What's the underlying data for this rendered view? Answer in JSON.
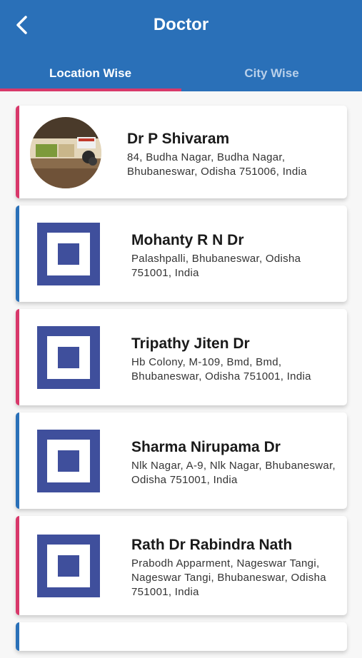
{
  "header": {
    "title": "Doctor"
  },
  "tabs": [
    {
      "label": "Location Wise",
      "active": true
    },
    {
      "label": "City Wise",
      "active": false
    }
  ],
  "colors": {
    "primary": "#2a70b8",
    "accent": "#d8386a",
    "placeholder": "#3f4f9c"
  },
  "doctors": [
    {
      "name": "Dr P Shivaram",
      "address": "84, Budha Nagar, Budha Nagar, Bhubaneswar, Odisha 751006, India",
      "image": "photo",
      "stripe": "pink"
    },
    {
      "name": "Mohanty R N Dr",
      "address": "Palashpalli, Bhubaneswar, Odisha 751001, India",
      "image": "placeholder-icon",
      "stripe": "blue"
    },
    {
      "name": "Tripathy Jiten Dr",
      "address": "Hb Colony, M-109, Bmd, Bmd, Bhubaneswar, Odisha 751001, India",
      "image": "placeholder-icon",
      "stripe": "pink"
    },
    {
      "name": "Sharma Nirupama Dr",
      "address": "Nlk Nagar, A-9, Nlk Nagar, Bhubaneswar, Odisha 751001, India",
      "image": "placeholder-icon",
      "stripe": "blue"
    },
    {
      "name": "Rath Dr Rabindra Nath",
      "address": "Prabodh Apparment, Nageswar Tangi, Nageswar Tangi, Bhubaneswar, Odisha 751001, India",
      "image": "placeholder-icon",
      "stripe": "pink"
    }
  ]
}
